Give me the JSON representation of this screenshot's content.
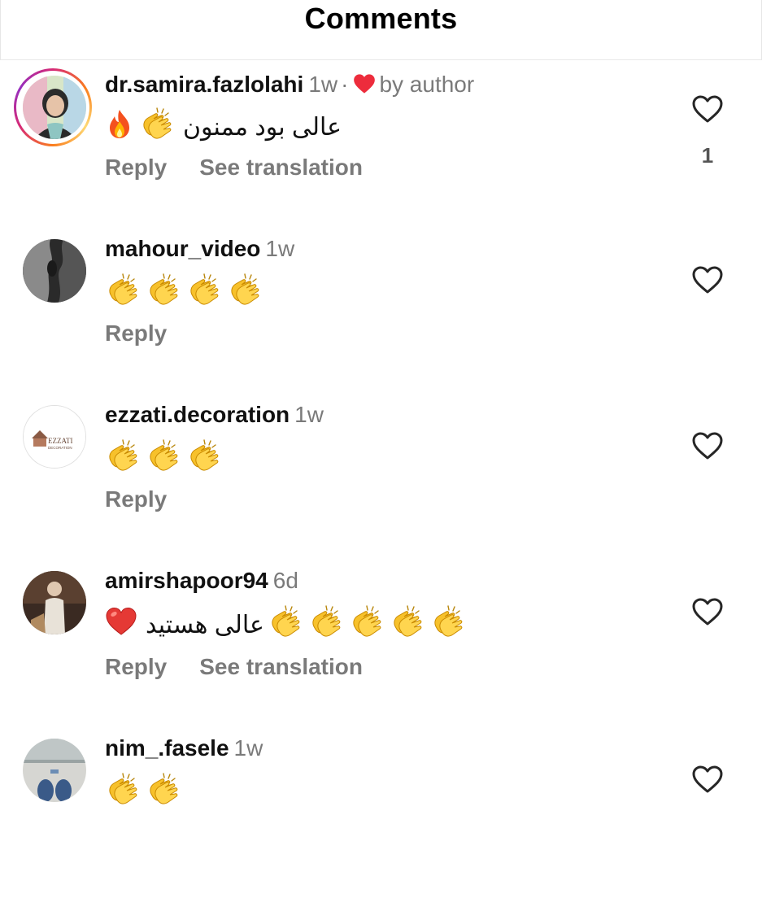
{
  "header": {
    "title": "Comments"
  },
  "comments": [
    {
      "username": "dr.samira.fazlolahi",
      "time": "1w",
      "dot": "·",
      "author_label": "by author",
      "text": "عالی بود ممنون",
      "reply_label": "Reply",
      "translate_label": "See translation",
      "like_count": "1"
    },
    {
      "username": "mahour_video",
      "time": "1w",
      "reply_label": "Reply"
    },
    {
      "username": "ezzati.decoration",
      "time": "1w",
      "reply_label": "Reply",
      "avatar_logo_text": "EZZATI",
      "avatar_logo_sub": "DECORATION"
    },
    {
      "username": "amirshapoor94",
      "time": "6d",
      "text": "عالی هستید",
      "reply_label": "Reply",
      "translate_label": "See translation"
    },
    {
      "username": "nim_.fasele",
      "time": "1w"
    }
  ],
  "icons": {
    "like": "heart-outline-icon",
    "author_like": "heart-filled-icon",
    "clap": "clapping-hands-emoji",
    "fire": "fire-emoji",
    "red_heart": "red-heart-emoji"
  },
  "colors": {
    "secondary_text": "#7a7a7a",
    "author_heart": "#ed2c3c"
  }
}
